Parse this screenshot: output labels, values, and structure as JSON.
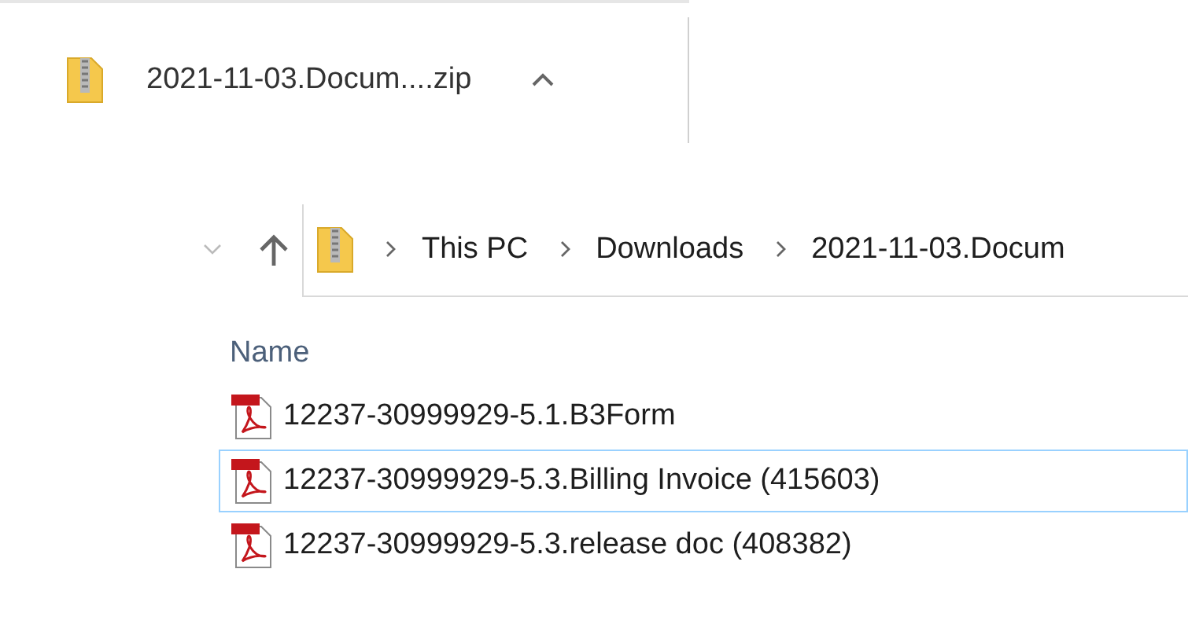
{
  "download_bar": {
    "file_name": "2021-11-03.Docum....zip"
  },
  "address_bar": {
    "path": [
      "This PC",
      "Downloads",
      "2021-11-03.Docum"
    ]
  },
  "file_list": {
    "columns": [
      "Name"
    ],
    "files": [
      {
        "name": "12237-30999929-5.1.B3Form",
        "selected": false
      },
      {
        "name": "12237-30999929-5.3.Billing Invoice (415603)",
        "selected": true
      },
      {
        "name": "12237-30999929-5.3.release doc (408382)",
        "selected": false
      }
    ]
  }
}
